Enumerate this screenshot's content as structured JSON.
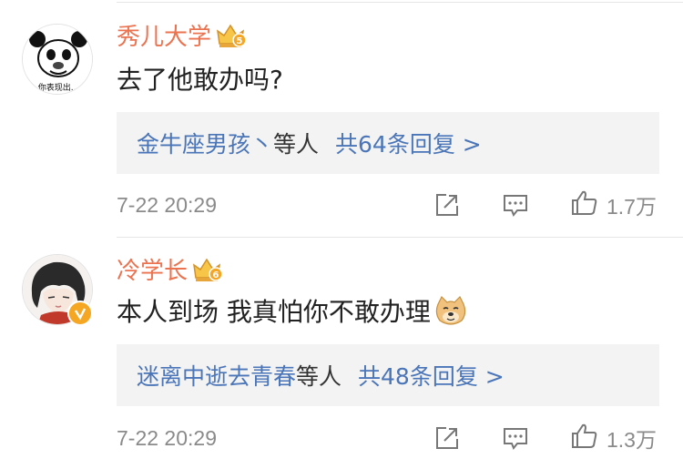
{
  "colors": {
    "username": "#eb7350",
    "link": "#4a75b8",
    "muted": "#8a8a8a",
    "reply_bg": "#f3f3f3",
    "badge": "#f5a623"
  },
  "comments": [
    {
      "username": "秀儿大学",
      "rank_badge": "5",
      "text": "去了他敢办吗?",
      "avatar": "panda-meme-avatar",
      "avatar_caption": "你表现出...",
      "reply": {
        "names": "金牛座男孩丶",
        "sep": "等人",
        "count": "共64条回复 >"
      },
      "timestamp": "7-22 20:29",
      "likes": "1.7万"
    },
    {
      "username": "冷学长",
      "rank_badge": "6",
      "text": "本人到场 我真怕你不敢办理",
      "emoji": "doge-emoji",
      "avatar": "anime-boy-avatar",
      "verified": true,
      "reply": {
        "names": "迷离中逝去青春",
        "sep": "等人",
        "count": "共48条回复 >"
      },
      "timestamp": "7-22 20:29",
      "likes": "1.3万"
    }
  ]
}
